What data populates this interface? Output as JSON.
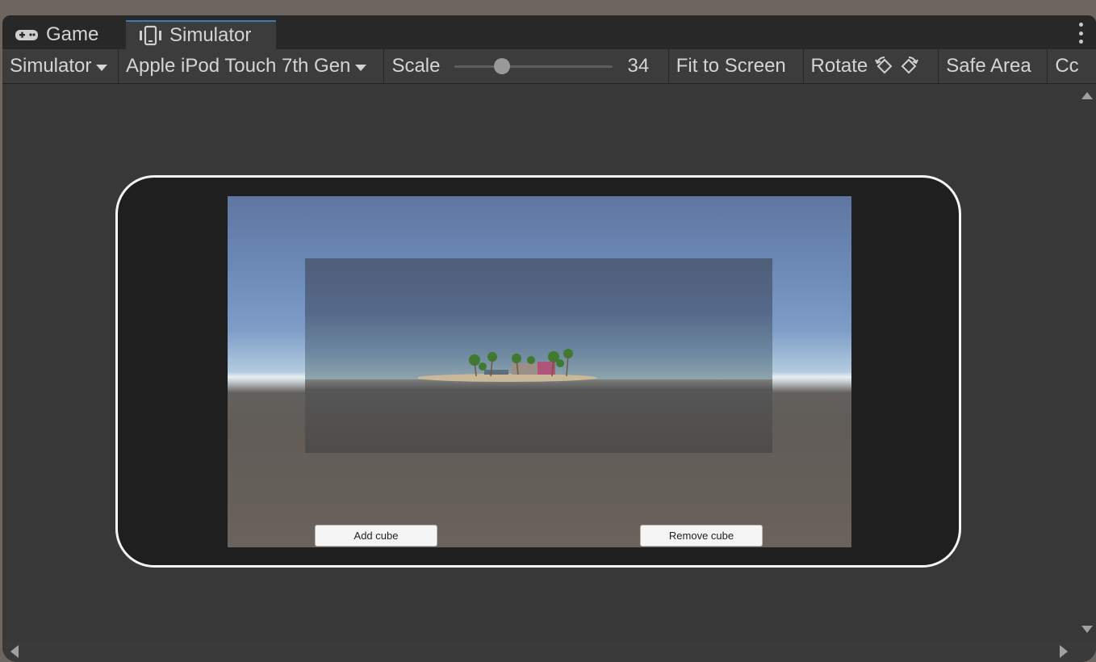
{
  "tabs": {
    "game_label": "Game",
    "simulator_label": "Simulator",
    "active": "Simulator"
  },
  "toolbar": {
    "mode_label": "Simulator",
    "device_label": "Apple iPod Touch 7th Gen",
    "scale_label": "Scale",
    "scale_value": "34",
    "scale_fraction": 0.3,
    "fit_label": "Fit to Screen",
    "rotate_label": "Rotate",
    "safe_area_label": "Safe Area",
    "overflow_label": "Cc"
  },
  "game": {
    "add_label": "Add cube",
    "remove_label": "Remove cube"
  },
  "colors": {
    "accent": "#3a79bb",
    "device_outline": "#f4f4f4"
  },
  "icons": [
    "gamepad-icon",
    "simulator-icon",
    "kebab-menu-icon",
    "rotate-left-icon",
    "rotate-right-icon"
  ]
}
